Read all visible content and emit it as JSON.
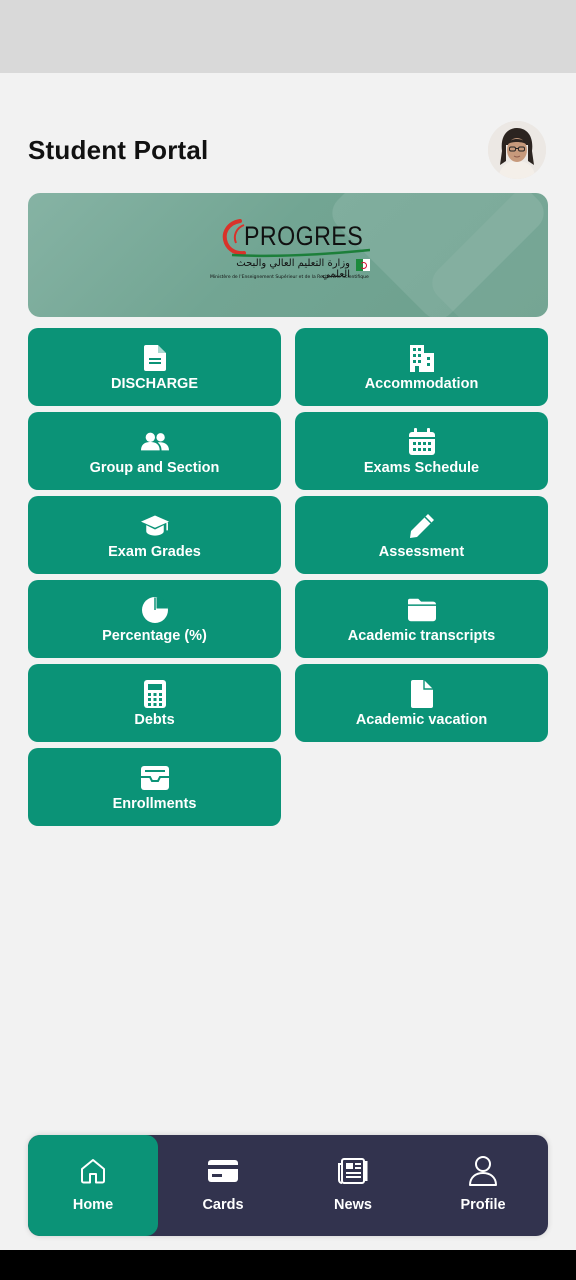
{
  "header": {
    "title": "Student Portal"
  },
  "banner": {
    "logo_text": "PROGRES",
    "logo_arabic": "وزارة التعليم العالي والبحث العلمي",
    "logo_french": "Ministère de l'Enseignement Supérieur et de la Recherche Scientifique"
  },
  "tiles": [
    {
      "label": "DISCHARGE",
      "icon": "document-icon"
    },
    {
      "label": "Accommodation",
      "icon": "building-icon"
    },
    {
      "label": "Group and Section",
      "icon": "users-icon"
    },
    {
      "label": "Exams Schedule",
      "icon": "calendar-icon"
    },
    {
      "label": "Exam Grades",
      "icon": "graduation-cap-icon"
    },
    {
      "label": "Assessment",
      "icon": "pencil-icon"
    },
    {
      "label": "Percentage (%)",
      "icon": "pie-chart-icon"
    },
    {
      "label": "Academic transcripts",
      "icon": "folder-icon"
    },
    {
      "label": "Debts",
      "icon": "calculator-icon"
    },
    {
      "label": "Academic vacation",
      "icon": "file-icon"
    },
    {
      "label": "Enrollments",
      "icon": "inbox-icon"
    }
  ],
  "nav": [
    {
      "label": "Home",
      "icon": "home-icon",
      "active": true
    },
    {
      "label": "Cards",
      "icon": "card-icon",
      "active": false
    },
    {
      "label": "News",
      "icon": "newspaper-icon",
      "active": false
    },
    {
      "label": "Profile",
      "icon": "user-icon",
      "active": false
    }
  ],
  "colors": {
    "accent": "#0b9377",
    "nav_background": "#32334e",
    "page_background": "#f2f2f2"
  }
}
